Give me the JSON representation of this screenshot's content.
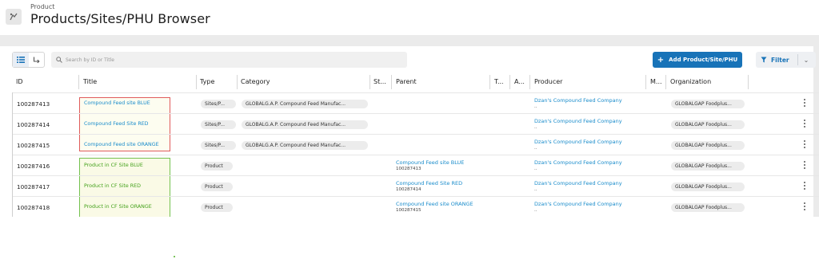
{
  "header": {
    "breadcrumb": "Product",
    "title": "Products/Sites/PHU Browser"
  },
  "toolbar": {
    "search_placeholder": "Search by ID or Title",
    "add_label": "Add Product/Site/PHU",
    "filter_label": "Filter"
  },
  "columns": {
    "id": "ID",
    "title": "Title",
    "type": "Type",
    "category": "Category",
    "st": "St...",
    "parent": "Parent",
    "t": "T...",
    "a": "A...",
    "producer": "Producer",
    "m": "M...",
    "organization": "Organization"
  },
  "rows": [
    {
      "id": "100287413",
      "title": "Compound Feed site BLUE",
      "type": "Sites/P...",
      "category": "GLOBALG.A.P. Compound Feed Manufac...",
      "parent": "",
      "parent_id": "",
      "producer": "Dzan's Compound Feed Company",
      "producer_sub": "..",
      "organization": "GLOBALGAP Foodplus..."
    },
    {
      "id": "100287414",
      "title": "Compound Feed Site RED",
      "type": "Sites/P...",
      "category": "GLOBALG.A.P. Compound Feed Manufac...",
      "parent": "",
      "parent_id": "",
      "producer": "Dzan's Compound Feed Company",
      "producer_sub": "..",
      "organization": "GLOBALGAP Foodplus..."
    },
    {
      "id": "100287415",
      "title": "Compound Feed site ORANGE",
      "type": "Sites/P...",
      "category": "GLOBALG.A.P. Compound Feed Manufac...",
      "parent": "",
      "parent_id": "",
      "producer": "Dzan's Compound Feed Company",
      "producer_sub": "..",
      "organization": "GLOBALGAP Foodplus..."
    },
    {
      "id": "100287416",
      "title": "Product in CF Site BLUE",
      "type": "Product",
      "category": "",
      "parent": "Compound Feed site BLUE",
      "parent_id": "100287413",
      "producer": "Dzan's Compound Feed Company",
      "producer_sub": "..",
      "organization": "GLOBALGAP Foodplus..."
    },
    {
      "id": "100287417",
      "title": "Product in CF Site RED",
      "type": "Product",
      "category": "",
      "parent": "Compound Feed Site RED",
      "parent_id": "100287414",
      "producer": "Dzan's Compound Feed Company",
      "producer_sub": "..",
      "organization": "GLOBALGAP Foodplus..."
    },
    {
      "id": "100287418",
      "title": "Product in CF Site ORANGE",
      "type": "Product",
      "category": "",
      "parent": "Compound Feed site ORANGE",
      "parent_id": "100287415",
      "producer": "Dzan's Compound Feed Company",
      "producer_sub": "..",
      "organization": "GLOBALGAP Foodplus..."
    }
  ],
  "colors": {
    "accent": "#1873b8",
    "link": "#1a8ccb",
    "highlight_red": "#e05b5b",
    "highlight_green": "#74c24f"
  }
}
